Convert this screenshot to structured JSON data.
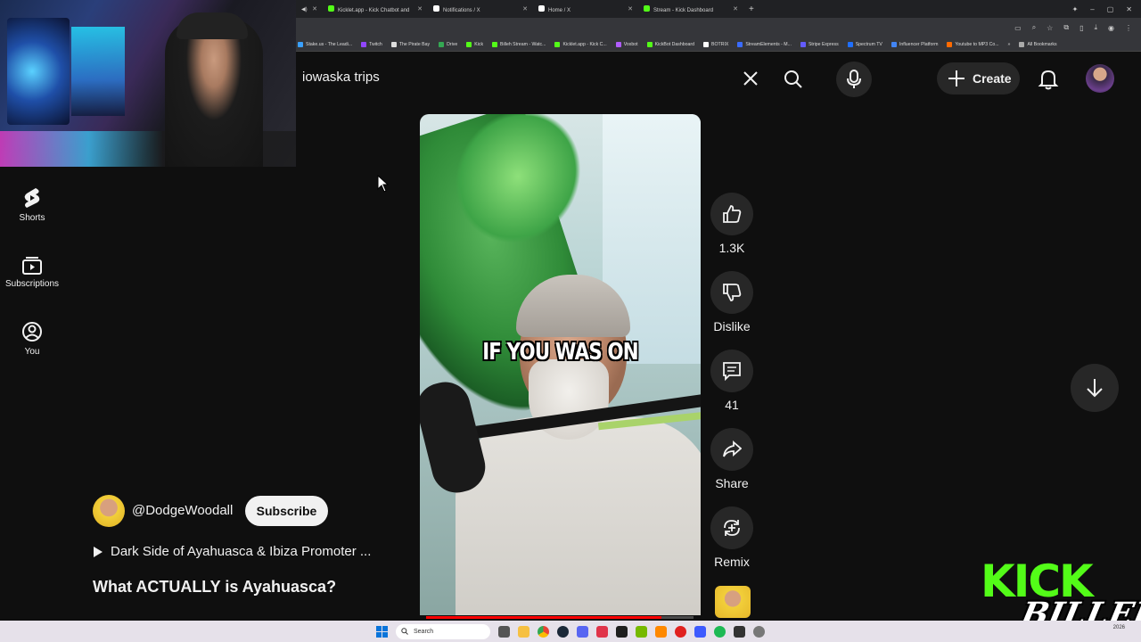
{
  "browser": {
    "tabs": [
      {
        "label": "Kicklet.app - Kick Chatbot and",
        "color": "#53fc18"
      },
      {
        "label": "Notifications / X",
        "color": "#ffffff"
      },
      {
        "label": "Home / X",
        "color": "#ffffff"
      },
      {
        "label": "Stream - Kick Dashboard",
        "color": "#53fc18"
      }
    ],
    "bookmarks": [
      {
        "label": "Stake.us - The Leadi...",
        "color": "#3aa0ff"
      },
      {
        "label": "Twitch",
        "color": "#9146ff"
      },
      {
        "label": "The Pirate Bay",
        "color": "#dddddd"
      },
      {
        "label": "Drive",
        "color": "#34a853"
      },
      {
        "label": "Kick",
        "color": "#53fc18"
      },
      {
        "label": "Billeh Stream - Watc...",
        "color": "#53fc18"
      },
      {
        "label": "Kicklet.app - Kick C...",
        "color": "#53fc18"
      },
      {
        "label": "Voxbot",
        "color": "#b05cff"
      },
      {
        "label": "KickBot Dashboard",
        "color": "#53fc18"
      },
      {
        "label": "BOTRIX",
        "color": "#ffffff"
      },
      {
        "label": "StreamElements - M...",
        "color": "#3a6bff"
      },
      {
        "label": "Stripe Express",
        "color": "#635bff"
      },
      {
        "label": "Spectrum TV",
        "color": "#1f6fff"
      },
      {
        "label": "Influencer Platform",
        "color": "#4285f4"
      },
      {
        "label": "Youtube to MP3 Co...",
        "color": "#ff6a00"
      }
    ],
    "all_bookmarks": "All Bookmarks"
  },
  "header": {
    "search_query": "iowaska trips",
    "create_label": "Create"
  },
  "nav": {
    "shorts": "Shorts",
    "subscriptions": "Subscriptions",
    "you": "You"
  },
  "video": {
    "caption": "IF YOU WAS ON",
    "progress": 0.88
  },
  "actions": {
    "likes": "1.3K",
    "dislike": "Dislike",
    "comments": "41",
    "share": "Share",
    "remix": "Remix"
  },
  "channel": {
    "handle": "@DodgeWoodall",
    "subscribe": "Subscribe",
    "playlist": "Dark Side of Ayahuasca & Ibiza Promoter ...",
    "title": "What ACTUALLY is Ayahuasca?"
  },
  "overlay": {
    "kick": "KICK",
    "name": "BILLEH"
  },
  "taskbar": {
    "search": "Search",
    "date": "2026"
  },
  "colors": {
    "accent": "#ff0000",
    "kick_green": "#53fc18",
    "background": "#0f0f0f"
  }
}
